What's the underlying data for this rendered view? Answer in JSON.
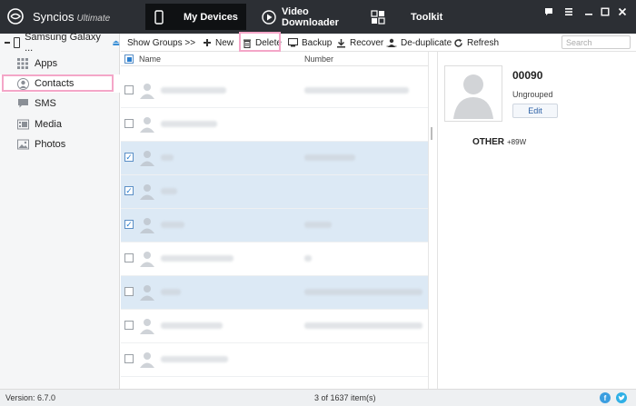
{
  "app": {
    "brand": "Syncios",
    "edition": "Ultimate",
    "version_text": "Version: 6.7.0"
  },
  "nav_tabs": [
    {
      "label": "My Devices",
      "active": true,
      "icon": "phone-icon"
    },
    {
      "label": "Video Downloader",
      "active": false,
      "icon": "play-icon"
    },
    {
      "label": "Toolkit",
      "active": false,
      "icon": "toolkit-icon"
    }
  ],
  "window_controls": [
    "chat-icon",
    "menu-icon",
    "minimize-icon",
    "maximize-icon",
    "close-icon"
  ],
  "sidebar": {
    "device_name": "Samsung Galaxy ...",
    "items": [
      {
        "label": "Apps",
        "icon": "apps-icon",
        "active": false
      },
      {
        "label": "Contacts",
        "icon": "contacts-icon",
        "active": true
      },
      {
        "label": "SMS",
        "icon": "sms-icon",
        "active": false
      },
      {
        "label": "Media",
        "icon": "media-icon",
        "active": false
      },
      {
        "label": "Photos",
        "icon": "photos-icon",
        "active": false
      }
    ]
  },
  "toolbar": {
    "show_groups": "Show Groups >>",
    "new": "New",
    "delete": "Delete",
    "backup": "Backup",
    "recover": "Recover",
    "deduplicate": "De-duplicate",
    "refresh": "Refresh",
    "search_placeholder": "Search"
  },
  "table": {
    "headers": {
      "name": "Name",
      "number": "Number"
    },
    "rows": [
      {
        "checked": false,
        "selected": false
      },
      {
        "checked": false,
        "selected": false
      },
      {
        "checked": true,
        "selected": true
      },
      {
        "checked": true,
        "selected": true
      },
      {
        "checked": true,
        "selected": true
      },
      {
        "checked": false,
        "selected": false
      },
      {
        "checked": false,
        "selected": true
      },
      {
        "checked": false,
        "selected": false
      },
      {
        "checked": false,
        "selected": false
      }
    ]
  },
  "detail": {
    "name": "00090",
    "group": "Ungrouped",
    "edit": "Edit",
    "phone_label": "OTHER",
    "phone_value": "+89W"
  },
  "status": {
    "count": "3 of 1637 item(s)"
  },
  "colors": {
    "titlebar": "#2c2f34",
    "selected_row": "#dce9f5",
    "highlight": "#f4a6c8",
    "accent": "#3a8fd6",
    "facebook": "#3b9ee0",
    "twitter": "#2fb0e6"
  }
}
